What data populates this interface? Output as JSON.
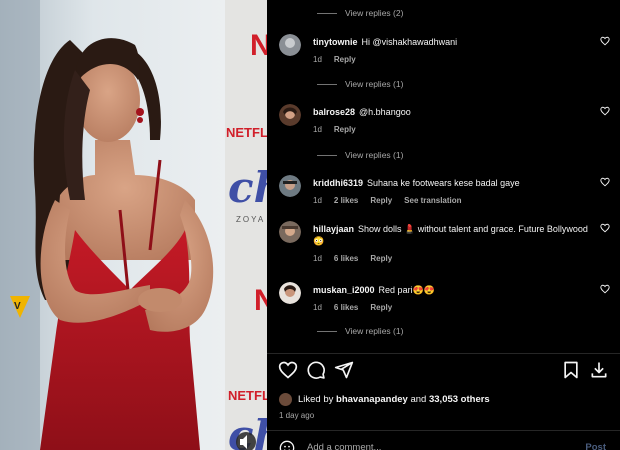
{
  "photo": {
    "brand_text": "NETFLIX",
    "poster_text": "chi",
    "poster_sub": "ZOYA",
    "watermark": "V"
  },
  "thread": {
    "top_view_replies": "View replies (2)",
    "comments": [
      {
        "username": "tinytownie",
        "text": "Hi @vishakhawadhwani",
        "time": "1d",
        "likes": "",
        "reply": "Reply",
        "translate": "",
        "view_replies": "View replies (1)"
      },
      {
        "username": "balrose28",
        "text": "@h.bhangoo",
        "time": "1d",
        "likes": "",
        "reply": "Reply",
        "translate": "",
        "view_replies": "View replies (1)"
      },
      {
        "username": "kriddhi6319",
        "text": "Suhana ke footwears kese badal gaye",
        "time": "1d",
        "likes": "2 likes",
        "reply": "Reply",
        "translate": "See translation",
        "view_replies": ""
      },
      {
        "username": "hillayjaan",
        "text": "Show dolls 💄 without talent and grace. Future Bollywood 😳",
        "time": "1d",
        "likes": "6 likes",
        "reply": "Reply",
        "translate": "",
        "view_replies": ""
      },
      {
        "username": "muskan_i2000",
        "text": "Red pari😍😍",
        "time": "1d",
        "likes": "6 likes",
        "reply": "Reply",
        "translate": "",
        "view_replies": "View replies (1)"
      }
    ]
  },
  "actions": {
    "icons": [
      "heart-icon",
      "comment-icon",
      "share-icon",
      "bookmark-icon",
      "download-icon"
    ]
  },
  "likes": {
    "prefix": "Liked by",
    "user": "bhavanapandey",
    "middle": "and",
    "others": "33,053 others"
  },
  "date": "1 day ago",
  "add_comment": {
    "placeholder": "Add a comment...",
    "post_label": "Post"
  },
  "colors": {
    "dress": "#b0141f",
    "background_wall": "#e9eef2",
    "panel_bg": "#000000",
    "link_blue": "#4a5d7e"
  }
}
